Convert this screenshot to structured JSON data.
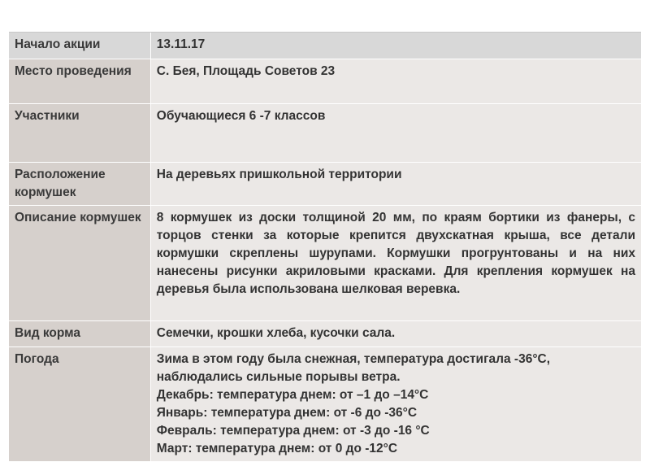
{
  "rows": [
    {
      "label": "Начало акции",
      "value": "13.11.17"
    },
    {
      "label": "Место проведения",
      "value": "С. Бея, Площадь Советов 23"
    },
    {
      "label": "Участники",
      "value": "Обучающиеся 6 -7 классов"
    },
    {
      "label": "Расположение кормушек",
      "value": "На деревьях пришкольной территории"
    },
    {
      "label": "Описание кормушек",
      "value": "8 кормушек из доски толщиной 20 мм, по краям  бортики  из фанеры, с торцов  стенки  за которые крепится двухскатная крыша, все детали кормушки скреплены шурупами. Кормушки прогрунтованы и на них нанесены рисунки акриловыми красками. Для крепления  кормушек на деревья была использована шелковая веревка."
    },
    {
      "label": "Вид корма",
      "value": "Семечки, крошки хлеба, кусочки сала."
    },
    {
      "label": "Погода",
      "lines": [
        "Зима в этом году была снежная, температура достигала -36°С, наблюдались сильные порывы ветра.",
        "Декабрь: температура днем: от –1 до –14°С",
        "Январь: температура днем: от -6 до -36°С",
        "Февраль: температура днем: от -3 до -16 °С",
        "Март: температура днем: от 0 до -12°С"
      ]
    }
  ]
}
